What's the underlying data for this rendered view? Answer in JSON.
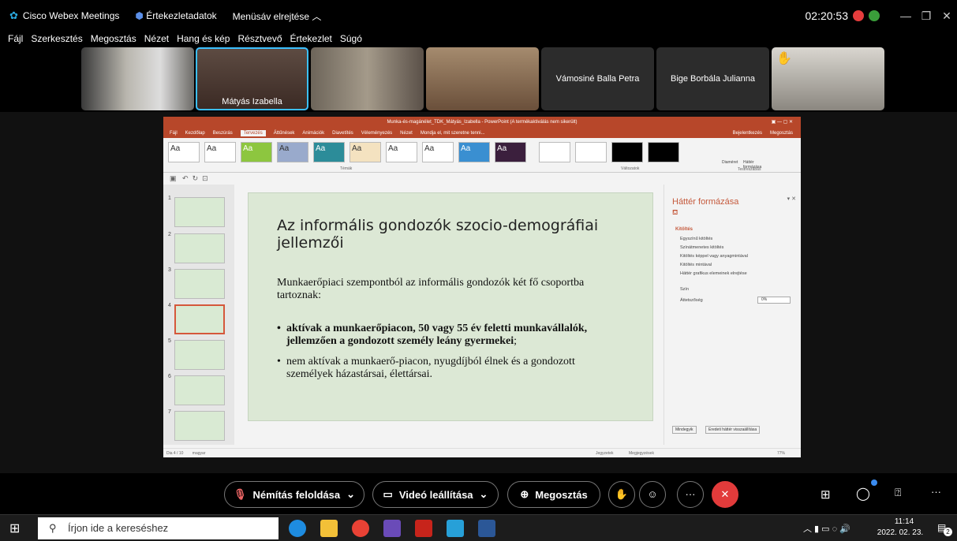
{
  "window": {
    "app": "Cisco Webex Meetings",
    "info": "Értekezletadatok",
    "hide_menu": "Menüsáv elrejtése ︿",
    "clock": "02:20:53"
  },
  "menu": [
    "Fájl",
    "Szerkesztés",
    "Megosztás",
    "Nézet",
    "Hang és kép",
    "Résztvevő",
    "Értekezlet",
    "Súgó"
  ],
  "participants": [
    {
      "name": ""
    },
    {
      "name": "Mátyás Izabella"
    },
    {
      "name": ""
    },
    {
      "name": ""
    },
    {
      "name": "Vámosiné Balla Petra"
    },
    {
      "name": "Bige Borbála Julianna"
    },
    {
      "name": ""
    }
  ],
  "ppt": {
    "title": "Munka-és-magánélet_TDK_Mátyás_Izabella - PowerPoint (A termékaktiválás nem sikerült)",
    "signin": "Bejelentkezés",
    "share": "Megosztás",
    "tabs": [
      "Fájl",
      "Kezdőlap",
      "Beszúrás",
      "Tervezés",
      "Áttűnések",
      "Animációk",
      "Diavetítés",
      "Véleményezés",
      "Nézet",
      "Mondja el, mit szeretne tenni..."
    ],
    "groups": {
      "themes": "Témák",
      "variants": "Változatok",
      "customize": "Testreszabás",
      "slide_size": "Diaméret",
      "bg_format": "Háttér formázása"
    },
    "slide_title": "Az informális gondozók szocio-demográfiai jellemzői",
    "intro": "Munkaerőpiaci szempontból az informális gondozók két fő csoportba tartoznak:",
    "b1": "aktívak a munkaerőpiacon, 50 vagy 55 év feletti munkavállalók, jellemzően a gondozott személy leány gyermekei",
    "b1_tail": ";",
    "b2": "nem aktívak a munkaerő-piacon, nyugdíjból élnek és a gondozott személyek házastársai, élettársai.",
    "pane": {
      "title": "Háttér formázása",
      "section": "Kitöltés",
      "opts": [
        "Egyszínű kitöltés",
        "Színátmenetes kitöltés",
        "Kitöltés képpel vagy anyagmintával",
        "Kitöltés mintával",
        "Háttér grafikus elemeinek elrejtése"
      ],
      "color": "Szín",
      "transp": "Áttetszőség",
      "transp_val": "0%",
      "apply_all": "Mindegyik",
      "reset": "Eredeti háttér visszaállítása"
    },
    "status": {
      "slide": "Dia 4 / 10",
      "lang": "magyar",
      "notes": "Jegyzetek",
      "comments": "Megjegyzések",
      "zoom": "77%"
    },
    "thumb_nums": [
      "1",
      "2",
      "3",
      "4",
      "5",
      "6",
      "7"
    ]
  },
  "controls": {
    "mute": "Némítás feloldása",
    "video": "Videó leállítása",
    "share": "Megosztás"
  },
  "taskbar": {
    "search": "Írjon ide a kereséshez",
    "time": "11:14",
    "date": "2022. 02. 23.",
    "notif": "2"
  }
}
